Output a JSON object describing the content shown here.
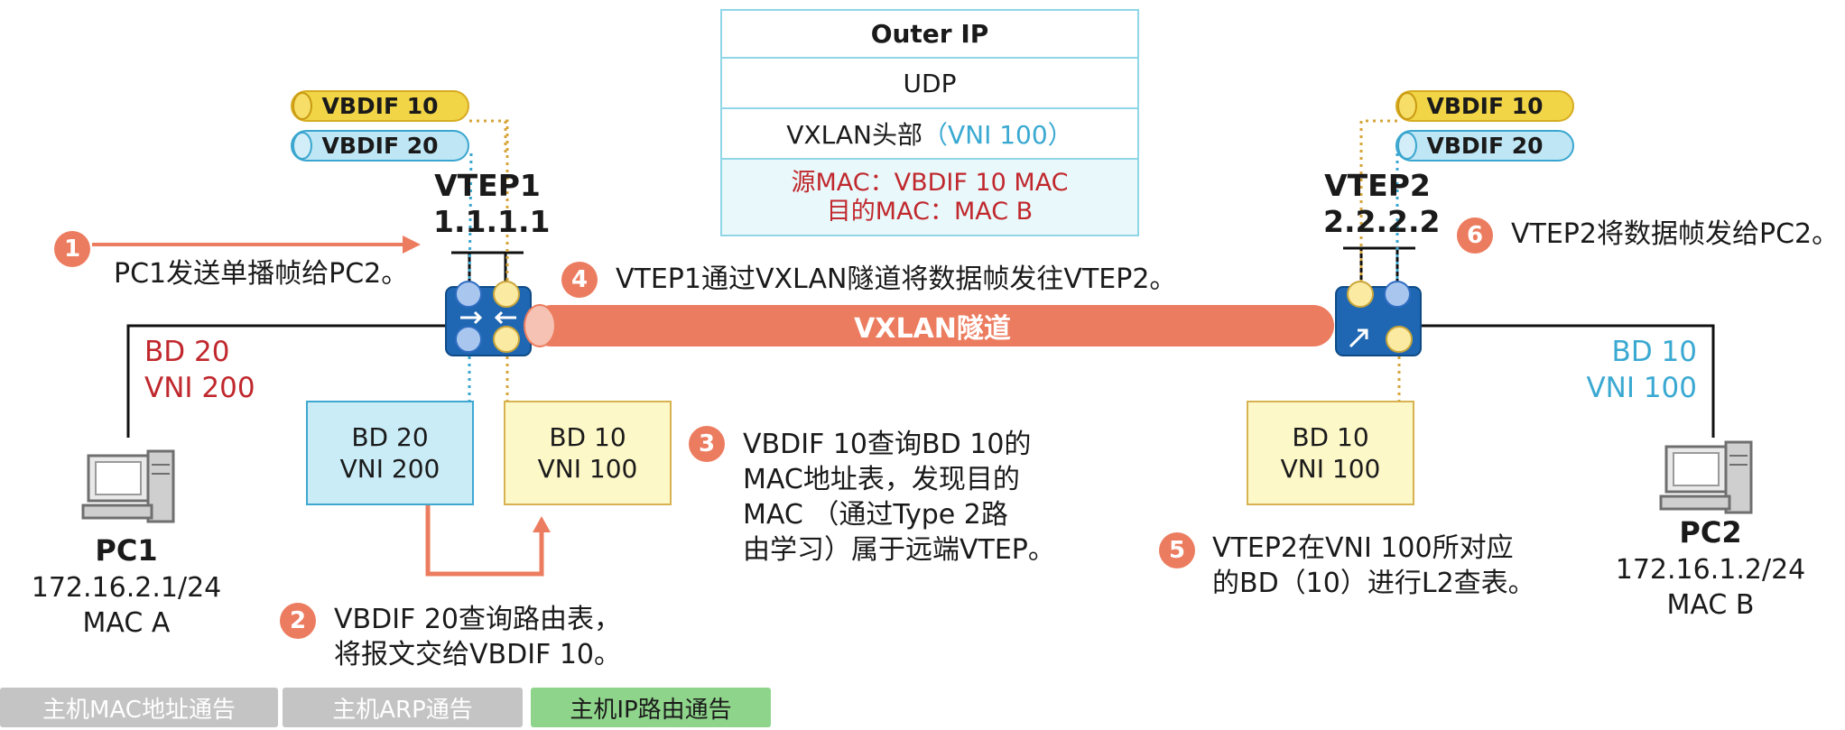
{
  "header_table": {
    "outer_ip": "Outer IP",
    "udp": "UDP",
    "vxlan_prefix": "VXLAN头部",
    "vxlan_vni": "（VNI 100）",
    "src_mac": "源MAC：VBDIF 10 MAC",
    "dst_mac": "目的MAC：MAC B"
  },
  "vtep1": {
    "vbdif_yellow": "VBDIF 10",
    "vbdif_blue": "VBDIF 20",
    "name": "VTEP1",
    "ip": "1.1.1.1",
    "bd_blue_line1": "BD 20",
    "bd_blue_line2": "VNI 200",
    "bd_yellow_line1": "BD 10",
    "bd_yellow_line2": "VNI 100",
    "left_label_line1": "BD 20",
    "left_label_line2": "VNI 200"
  },
  "vtep2": {
    "vbdif_yellow": "VBDIF 10",
    "vbdif_blue": "VBDIF 20",
    "name": "VTEP2",
    "ip": "2.2.2.2",
    "bd_yellow_line1": "BD 10",
    "bd_yellow_line2": "VNI 100",
    "right_label_line1": "BD 10",
    "right_label_line2": "VNI 100"
  },
  "tunnel_label": "VXLAN隧道",
  "pc1": {
    "name": "PC1",
    "ip": "172.16.2.1/24",
    "mac": "MAC A"
  },
  "pc2": {
    "name": "PC2",
    "ip": "172.16.1.2/24",
    "mac": "MAC B"
  },
  "steps": [
    {
      "num": "1",
      "text": "PC1发送单播帧给PC2。"
    },
    {
      "num": "2",
      "line1": "VBDIF 20查询路由表，",
      "line2": "将报文交给VBDIF 10。"
    },
    {
      "num": "3",
      "line1": "VBDIF 10查询BD 10的",
      "line2": "MAC地址表，发现目的",
      "line3": "MAC （通过Type 2路",
      "line4": "由学习）属于远端VTEP。"
    },
    {
      "num": "4",
      "text": "VTEP1通过VXLAN隧道将数据帧发往VTEP2。"
    },
    {
      "num": "5",
      "line1": "VTEP2在VNI 100所对应",
      "line2": "的BD（10）进行L2查表。"
    },
    {
      "num": "6",
      "text": "VTEP2将数据帧发给PC2。"
    }
  ],
  "tabs": [
    {
      "label": "主机MAC地址通告",
      "active": false
    },
    {
      "label": "主机ARP通告",
      "active": false
    },
    {
      "label": "主机IP路由通告",
      "active": true
    }
  ],
  "colors": {
    "accent_orange": "#ec7c5f",
    "blue": "#3aa9d2",
    "yellow": "#f1d547",
    "red": "#c0282d",
    "tab_active": "#8fd48b",
    "tab_inactive": "#c4c4c4"
  }
}
